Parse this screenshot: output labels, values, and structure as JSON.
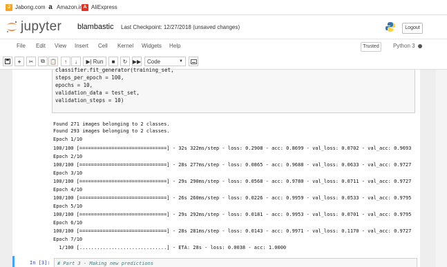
{
  "bookmarks": [
    {
      "label": "Jabong.com",
      "icon": "jabong-icon",
      "color": "#f5a623",
      "glyph": "J"
    },
    {
      "label": "Amazon.in",
      "icon": "amazon-icon",
      "color": "#222222",
      "glyph": "a"
    },
    {
      "label": "AliExpress",
      "icon": "aliexpress-icon",
      "color": "#e43225",
      "glyph": "A"
    }
  ],
  "header": {
    "logo_text": "jupyter",
    "notebook_name": "blambastic",
    "checkpoint": "Last Checkpoint: 12/27/2018",
    "status": "(unsaved changes)",
    "logout_label": "Logout"
  },
  "menu": {
    "items": [
      "File",
      "Edit",
      "View",
      "Insert",
      "Cell",
      "Kernel",
      "Widgets",
      "Help"
    ],
    "trusted_label": "Trusted",
    "kernel_label": "Python 3"
  },
  "toolbar": {
    "run_label": "Run",
    "cell_type": "Code"
  },
  "cell": {
    "code_lines": [
      "classifier.fit_generator(training_set,",
      "steps_per_epoch = 100,",
      "epochs = 10,",
      "validation_data = test_set,",
      "validation_steps = 10)"
    ],
    "output_lines": [
      "Found 271 images belonging to 2 classes.",
      "Found 293 images belonging to 2 classes.",
      "Epoch 1/10",
      "100/100 [==============================] - 32s 322ms/step - loss: 0.2908 - acc: 0.8699 - val_loss: 0.0702 - val_acc: 0.9693",
      "Epoch 2/10",
      "100/100 [==============================] - 28s 277ms/step - loss: 0.0865 - acc: 0.9688 - val_loss: 0.0633 - val_acc: 0.9727",
      "Epoch 3/10",
      "100/100 [==============================] - 29s 290ms/step - loss: 0.0568 - acc: 0.9780 - val_loss: 0.0711 - val_acc: 0.9727",
      "Epoch 4/10",
      "100/100 [==============================] - 26s 260ms/step - loss: 0.0226 - acc: 0.9959 - val_loss: 0.0533 - val_acc: 0.9795",
      "Epoch 5/10",
      "100/100 [==============================] - 29s 292ms/step - loss: 0.0181 - acc: 0.9953 - val_loss: 0.0701 - val_acc: 0.9795",
      "Epoch 6/10",
      "100/100 [==============================] - 28s 281ms/step - loss: 0.0143 - acc: 0.9971 - val_loss: 0.1170 - val_acc: 0.9727",
      "Epoch 7/10",
      "  1/100 [..............................] - ETA: 28s - loss: 0.0038 - acc: 1.0000"
    ]
  },
  "next_cell": {
    "prompt": "In [3]:",
    "comment": "# Part 3 - Making new predictions"
  },
  "colors": {
    "accent": "#42a5f5",
    "jupyter_orange": "#f37726"
  }
}
